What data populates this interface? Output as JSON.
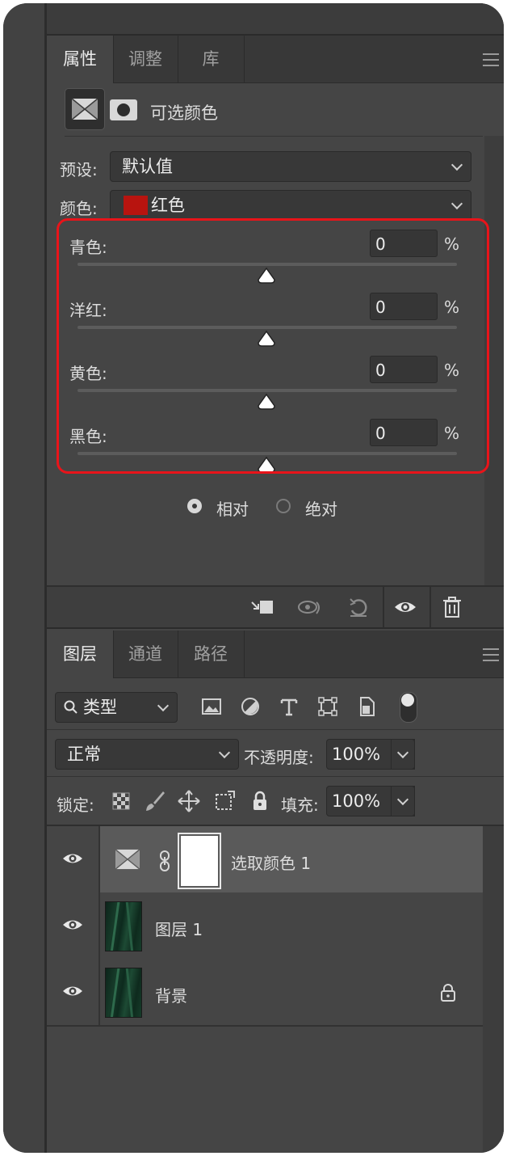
{
  "properties_panel": {
    "tabs": [
      "属性",
      "调整",
      "库"
    ],
    "header_title": "可选颜色",
    "preset_label": "预设:",
    "preset_value": "默认值",
    "color_label": "颜色:",
    "color_value": "红色",
    "color_swatch": "#b8140f",
    "sliders": [
      {
        "label": "青色:",
        "value": "0",
        "unit": "%"
      },
      {
        "label": "洋红:",
        "value": "0",
        "unit": "%"
      },
      {
        "label": "黄色:",
        "value": "0",
        "unit": "%"
      },
      {
        "label": "黑色:",
        "value": "0",
        "unit": "%"
      }
    ],
    "method_relative": "相对",
    "method_absolute": "绝对",
    "method_selected": "相对",
    "highlight_color": "#e8141a"
  },
  "layers_panel": {
    "tabs": [
      "图层",
      "通道",
      "路径"
    ],
    "filter_label": "类型",
    "blend_mode": "正常",
    "opacity_label": "不透明度:",
    "opacity_value": "100%",
    "lock_label": "锁定:",
    "fill_label": "填充:",
    "fill_value": "100%",
    "layers": [
      {
        "name": "选取颜色 1",
        "selected": true
      },
      {
        "name": "图层 1",
        "selected": false
      },
      {
        "name": "背景",
        "selected": false,
        "locked": true
      }
    ]
  }
}
